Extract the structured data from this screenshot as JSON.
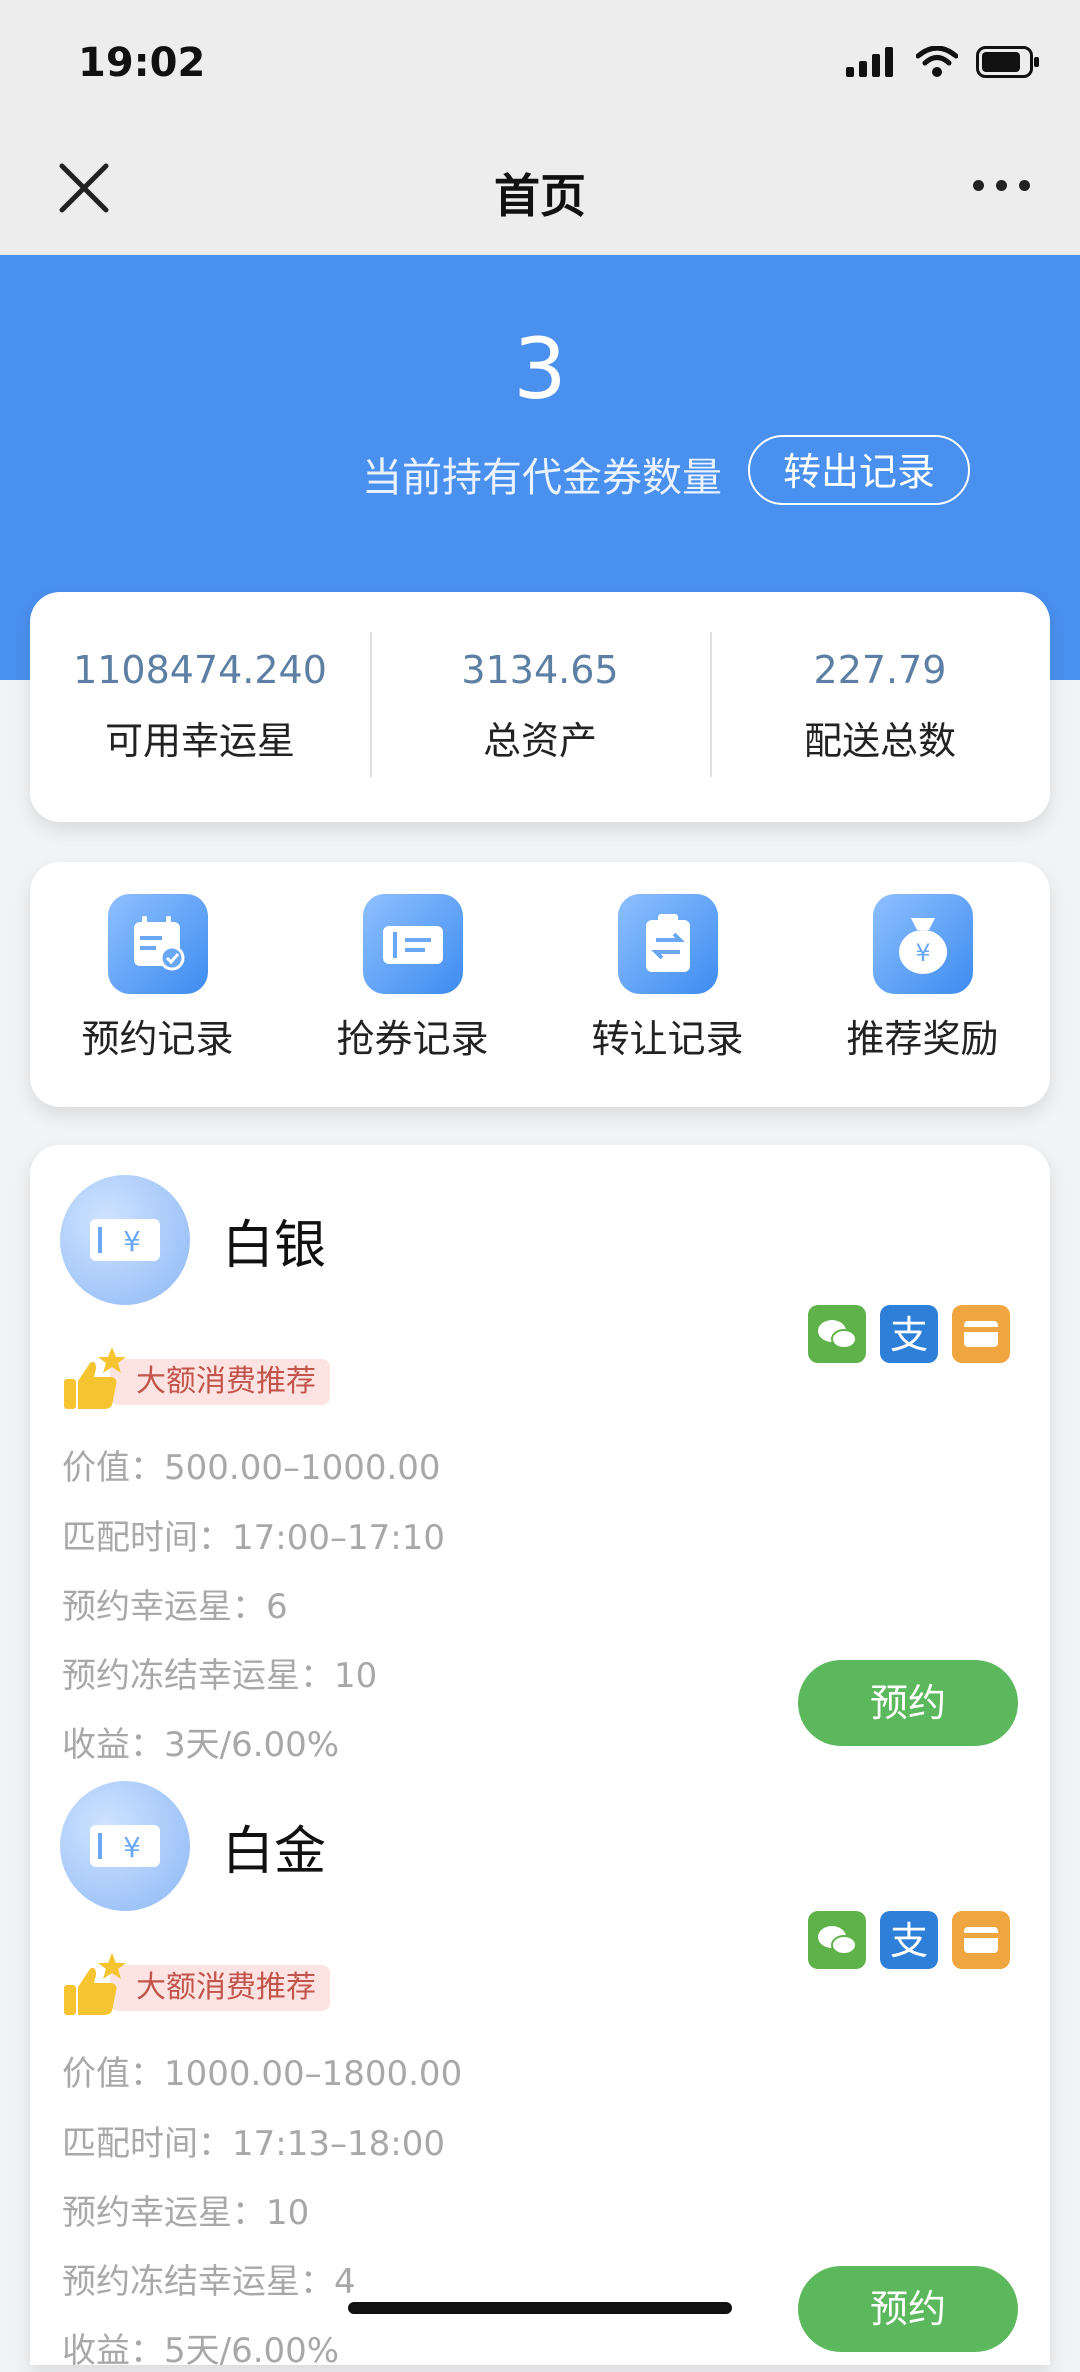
{
  "status_bar": {
    "time": "19:02"
  },
  "nav": {
    "title": "首页"
  },
  "hero": {
    "count": "3",
    "label": "当前持有代金券数量",
    "transfer_button": "转出记录"
  },
  "stats": [
    {
      "value": "1108474.240",
      "label": "可用幸运星"
    },
    {
      "value": "3134.65",
      "label": "总资产"
    },
    {
      "value": "227.79",
      "label": "配送总数"
    }
  ],
  "shortcuts": [
    {
      "label": "预约记录",
      "icon": "calendar-icon"
    },
    {
      "label": "抢券记录",
      "icon": "ticket-icon"
    },
    {
      "label": "转让记录",
      "icon": "transfer-clipboard-icon"
    },
    {
      "label": "推荐奖励",
      "icon": "money-bag-icon"
    }
  ],
  "products": [
    {
      "name": "白银",
      "tag": "大额消费推荐",
      "value": "价值：500.00–1000.00",
      "match_time": "匹配时间：17:00–17:10",
      "reserve_stars": "预约幸运星：6",
      "frozen_stars": "预约冻结幸运星：10",
      "profit": "收益：3天/6.00%",
      "button": "预约"
    },
    {
      "name": "白金",
      "tag": "大额消费推荐",
      "value": "价值：1000.00–1800.00",
      "match_time": "匹配时间：17:13–18:00",
      "reserve_stars": "预约幸运星：10",
      "frozen_stars": "预约冻结幸运星：4",
      "profit": "收益：5天/6.00%",
      "button": "预约"
    }
  ],
  "colors": {
    "hero_blue": "#4a90ee",
    "reserve_green": "#5cb85c",
    "stat_value": "#5c7fa3"
  }
}
